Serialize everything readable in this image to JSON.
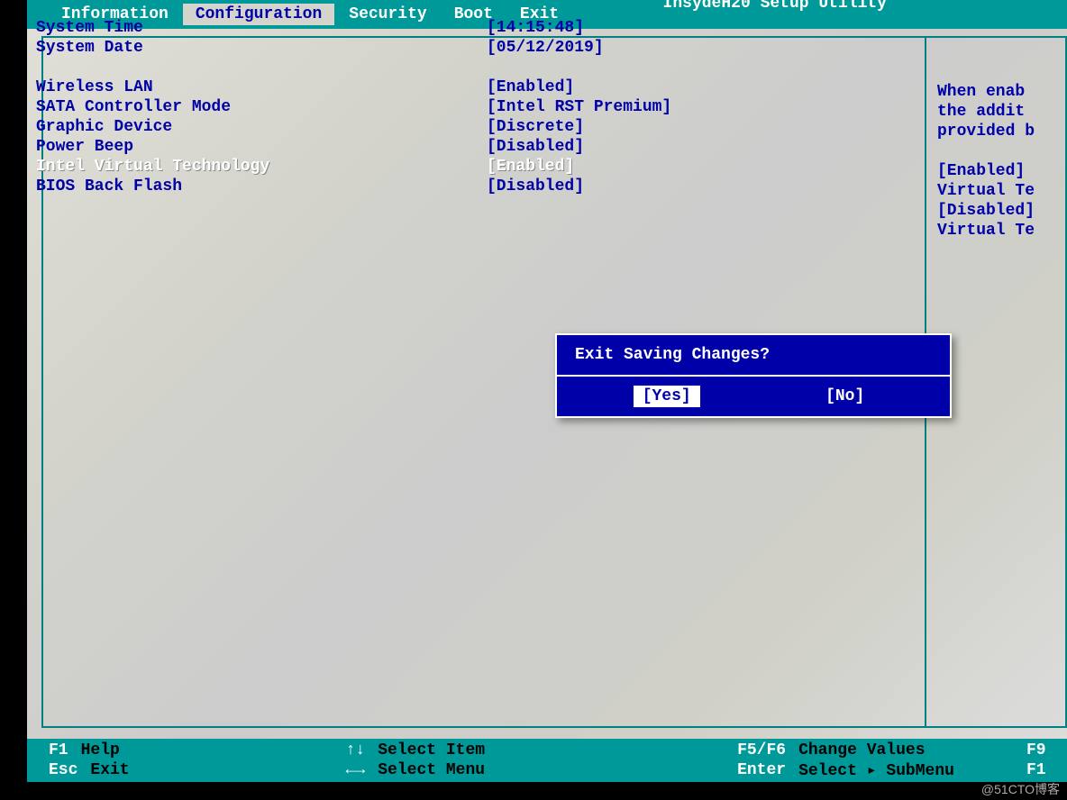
{
  "bios_title": "InsydeH20 Setup Utility",
  "tabs": [
    {
      "label": "Information",
      "active": false
    },
    {
      "label": "Configuration",
      "active": true
    },
    {
      "label": "Security",
      "active": false
    },
    {
      "label": "Boot",
      "active": false
    },
    {
      "label": "Exit",
      "active": false
    }
  ],
  "settings": [
    {
      "label": "System Time",
      "value": "[14:15:48]",
      "blank_after": false
    },
    {
      "label": "System Date",
      "value": "[05/12/2019]",
      "blank_after": true
    },
    {
      "label": "Wireless LAN",
      "value": "[Enabled]",
      "blank_after": false
    },
    {
      "label": "SATA Controller Mode",
      "value": "[Intel RST Premium]",
      "blank_after": false
    },
    {
      "label": "Graphic Device",
      "value": "[Discrete]",
      "blank_after": false
    },
    {
      "label": "Power Beep",
      "value": "[Disabled]",
      "blank_after": false
    },
    {
      "label": "Intel Virtual Technology",
      "value": "[Enabled]",
      "blank_after": false,
      "selected": true
    },
    {
      "label": "BIOS Back Flash",
      "value": "[Disabled]",
      "blank_after": false
    }
  ],
  "help_panel": {
    "lines": [
      "",
      "When enab",
      "the addit",
      "provided b",
      "",
      "[Enabled]",
      "Virtual Te",
      "[Disabled]",
      "Virtual Te"
    ]
  },
  "dialog": {
    "title": "Exit Saving Changes?",
    "yes": "[Yes]",
    "no": "[No]",
    "selected": "yes"
  },
  "footer": {
    "col1": [
      {
        "key": "F1",
        "action": "Help"
      },
      {
        "key": "Esc",
        "action": "Exit"
      }
    ],
    "col2": [
      {
        "key": "↑↓",
        "action": "Select Item"
      },
      {
        "key": "←→",
        "action": "Select Menu"
      }
    ],
    "col3": [
      {
        "key": "F5/F6",
        "action": "Change Values"
      },
      {
        "key": "Enter",
        "action": "Select ▸ SubMenu"
      }
    ],
    "col4": [
      {
        "key": "F9",
        "action": ""
      },
      {
        "key": "F1",
        "action": ""
      }
    ]
  },
  "watermark": "@51CTO博客"
}
